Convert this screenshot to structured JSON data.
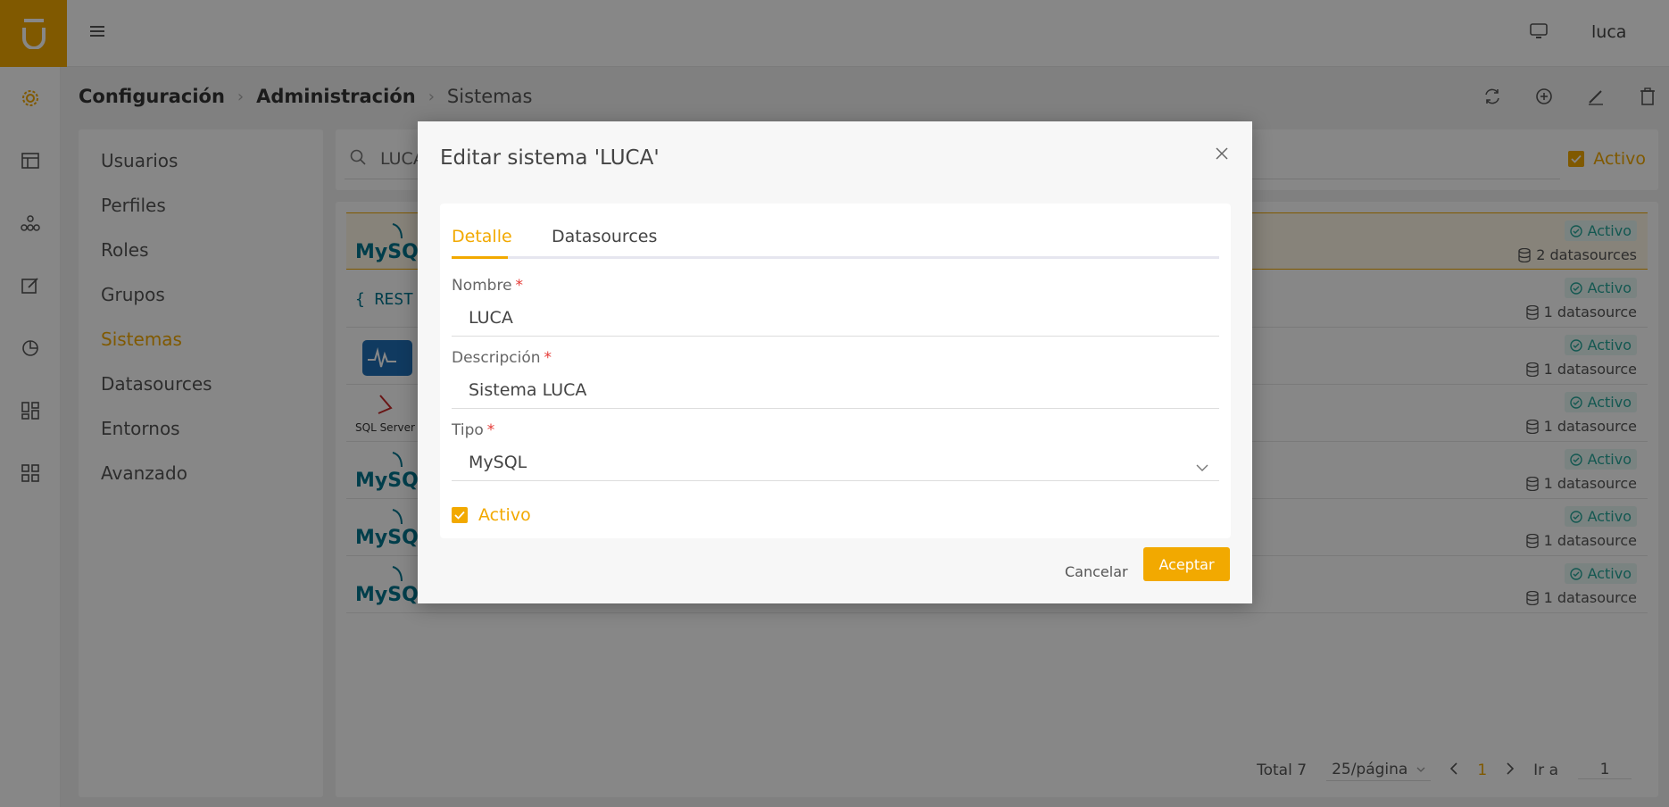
{
  "user": {
    "name": "luca"
  },
  "breadcrumb": {
    "level1": "Configuración",
    "level2": "Administración",
    "level3": "Sistemas"
  },
  "menu": {
    "items": [
      {
        "label": "Usuarios"
      },
      {
        "label": "Perfiles"
      },
      {
        "label": "Roles"
      },
      {
        "label": "Grupos"
      },
      {
        "label": "Sistemas",
        "active": true
      },
      {
        "label": "Datasources"
      },
      {
        "label": "Entornos"
      },
      {
        "label": "Avanzado"
      }
    ]
  },
  "search": {
    "value": "LUCA",
    "active_label": "Activo"
  },
  "list": {
    "rows": [
      {
        "logo": "mysql-logo",
        "status": "Activo",
        "datasources": "2 datasources"
      },
      {
        "logo": "rest-logo",
        "status": "Activo",
        "datasources": "1 datasource"
      },
      {
        "logo": "wave-logo",
        "status": "Activo",
        "datasources": "1 datasource"
      },
      {
        "logo": "sqlserver-logo",
        "status": "Activo",
        "datasources": "1 datasource"
      },
      {
        "logo": "mysql-logo",
        "status": "Activo",
        "datasources": "1 datasource"
      },
      {
        "logo": "mysql-logo",
        "status": "Activo",
        "datasources": "1 datasource"
      },
      {
        "logo": "mysql-logo",
        "status": "Activo",
        "datasources": "1 datasource"
      }
    ]
  },
  "logos": {
    "mysql": "MySQL",
    "rest": "{ REST",
    "sqlserver": "SQL Server"
  },
  "pagination": {
    "total": "Total 7",
    "page_size": "25/página",
    "current": "1",
    "goto_label": "Ir a",
    "goto_value": "1"
  },
  "modal": {
    "title": "Editar sistema 'LUCA'",
    "tabs": [
      {
        "label": "Detalle"
      },
      {
        "label": "Datasources"
      }
    ],
    "fields": {
      "nombre": {
        "label": "Nombre",
        "value": "LUCA"
      },
      "descripcion": {
        "label": "Descripción",
        "value": "Sistema LUCA"
      },
      "tipo": {
        "label": "Tipo",
        "value": "MySQL"
      }
    },
    "required_mark": "*",
    "active_label": "Activo",
    "cancel_label": "Cancelar",
    "accept_label": "Aceptar"
  },
  "colors": {
    "accent": "#f2a900",
    "status": "#26a69a",
    "required": "#e53935"
  }
}
